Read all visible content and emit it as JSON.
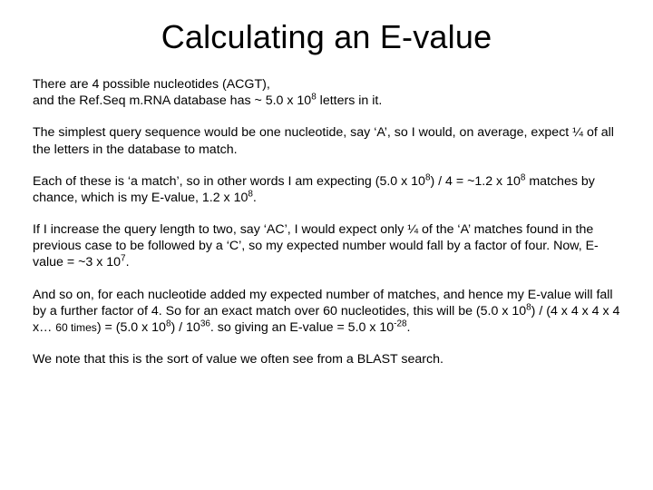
{
  "title": "Calculating an E-value",
  "p1a": "There are 4 possible nucleotides (ACGT),",
  "p1b_pre": "and the Ref.Seq m.RNA database has ~ 5.0 x 10",
  "p1b_sup": "8",
  "p1b_post": "  letters in it.",
  "p2": "The simplest query sequence would be one nucleotide, say ‘A’, so I would, on average, expect ¼ of all the letters in the database to match.",
  "p3_a": "Each of these is ‘a match’, so in other words I am expecting (5.0 x 10",
  "p3_sup1": "8",
  "p3_b": ") / 4 = ~1.2 x 10",
  "p3_sup2": "8",
  "p3_c": " matches by chance, which is my E-value, 1.2 x 10",
  "p3_sup3": "8",
  "p3_d": ".",
  "p4_a": "If I increase the query length to two, say ‘AC’, I would expect only ¼ of the ‘A’ matches found in the previous case to be followed by a ‘C’, so my expected number would fall by a factor of four. Now, E-value = ~3 x 10",
  "p4_sup": "7",
  "p4_b": ".",
  "p5_a": "And so on, for each nucleotide added my expected number of matches, and hence my E-value will fall by a further factor of 4. So for an exact match over 60 nucleotides, this will be (5.0 x 10",
  "p5_sup1": "8",
  "p5_b": ") / (4 x 4 x 4 x 4 x… ",
  "p5_times": "60 times",
  "p5_c": ") = (5.0 x 10",
  "p5_sup2": "8",
  "p5_d": ") / 10",
  "p5_sup3": "36",
  "p5_e": ". so giving an E-value = 5.0 x 10",
  "p5_sup4": "-28",
  "p5_f": ".",
  "p6": "We note that this is the sort of value we often see from a BLAST search."
}
